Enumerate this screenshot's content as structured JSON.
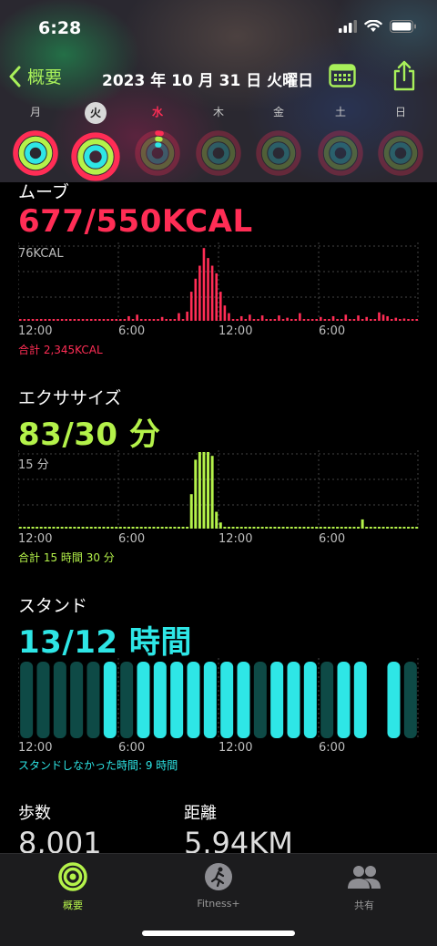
{
  "status": {
    "time": "6:28"
  },
  "nav": {
    "back_label": "概要",
    "title": "2023 年 10 月 31 日 火曜日"
  },
  "week": [
    {
      "label": "月",
      "state": "past",
      "move": 1.0,
      "exercise": 1.0,
      "stand": 1.0
    },
    {
      "label": "火",
      "state": "selected",
      "move": 1.0,
      "exercise": 1.0,
      "stand": 1.0
    },
    {
      "label": "水",
      "state": "today",
      "move": 0.03,
      "exercise": 0.03,
      "stand": 0.03
    },
    {
      "label": "木",
      "state": "future"
    },
    {
      "label": "金",
      "state": "future"
    },
    {
      "label": "土",
      "state": "future"
    },
    {
      "label": "日",
      "state": "future"
    }
  ],
  "move": {
    "title": "ムーブ",
    "value": "677/550KCAL",
    "chart_max_label": "76KCAL",
    "x_labels": [
      "12:00",
      "6:00",
      "12:00",
      "6:00"
    ],
    "total": "合計 2,345KCAL",
    "color": "#ff2d55"
  },
  "exercise": {
    "title": "エクササイズ",
    "value": "83/30 分",
    "chart_max_label": "15 分",
    "x_labels": [
      "12:00",
      "6:00",
      "12:00",
      "6:00"
    ],
    "total": "合計 15 時間 30 分",
    "color": "#b4f24a"
  },
  "stand": {
    "title": "スタンド",
    "value": "13/12 時間",
    "x_labels": [
      "12:00",
      "6:00",
      "12:00",
      "6:00"
    ],
    "total": "スタンドしなかった時間: 9 時間",
    "color": "#2ee6e6"
  },
  "stats": {
    "steps_title": "歩数",
    "steps_value": "8,001",
    "distance_title": "距離",
    "distance_value": "5.94KM"
  },
  "tabs": [
    {
      "label": "概要",
      "icon": "activity-rings-icon",
      "active": true
    },
    {
      "label": "Fitness+",
      "icon": "fitness-runner-icon",
      "active": false
    },
    {
      "label": "共有",
      "icon": "people-icon",
      "active": false
    }
  ]
}
